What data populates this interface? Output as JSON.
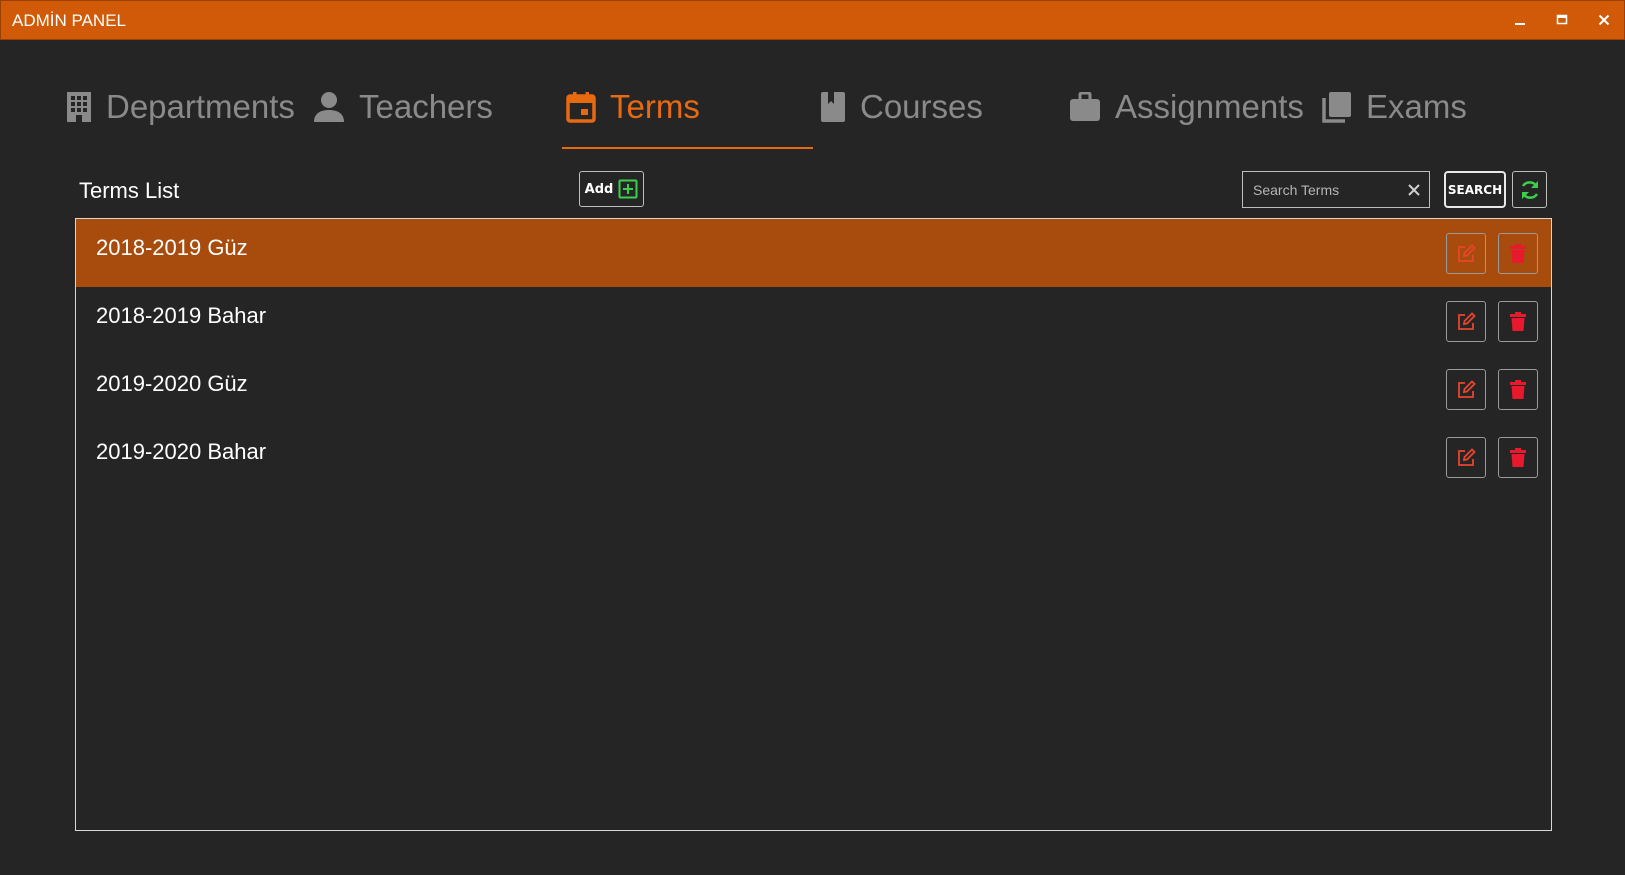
{
  "window": {
    "title": "ADMİN PANEL"
  },
  "tabs": [
    {
      "label": "Departments",
      "icon": "building-icon",
      "active": false
    },
    {
      "label": "Teachers",
      "icon": "user-icon",
      "active": false
    },
    {
      "label": "Terms",
      "icon": "calendar-icon",
      "active": true
    },
    {
      "label": "Courses",
      "icon": "book-icon",
      "active": false
    },
    {
      "label": "Assignments",
      "icon": "briefcase-icon",
      "active": false
    },
    {
      "label": "Exams",
      "icon": "copy-icon",
      "active": false
    }
  ],
  "list": {
    "title": "Terms List",
    "add_label": "Add",
    "search_placeholder": "Search Terms",
    "search_value": "",
    "search_label": "SEARCH",
    "items": [
      {
        "label": "2018-2019 Güz",
        "selected": true
      },
      {
        "label": "2018-2019 Bahar",
        "selected": false
      },
      {
        "label": "2019-2020 Güz",
        "selected": false
      },
      {
        "label": "2019-2020 Bahar",
        "selected": false
      }
    ]
  },
  "colors": {
    "accent": "#d05a07",
    "active_tab": "#e86a10",
    "selected_row": "#a84c0e",
    "background": "#252526",
    "add_green": "#3ccf4e",
    "delete_red": "#e8192c",
    "edit_red": "#e8452c"
  }
}
